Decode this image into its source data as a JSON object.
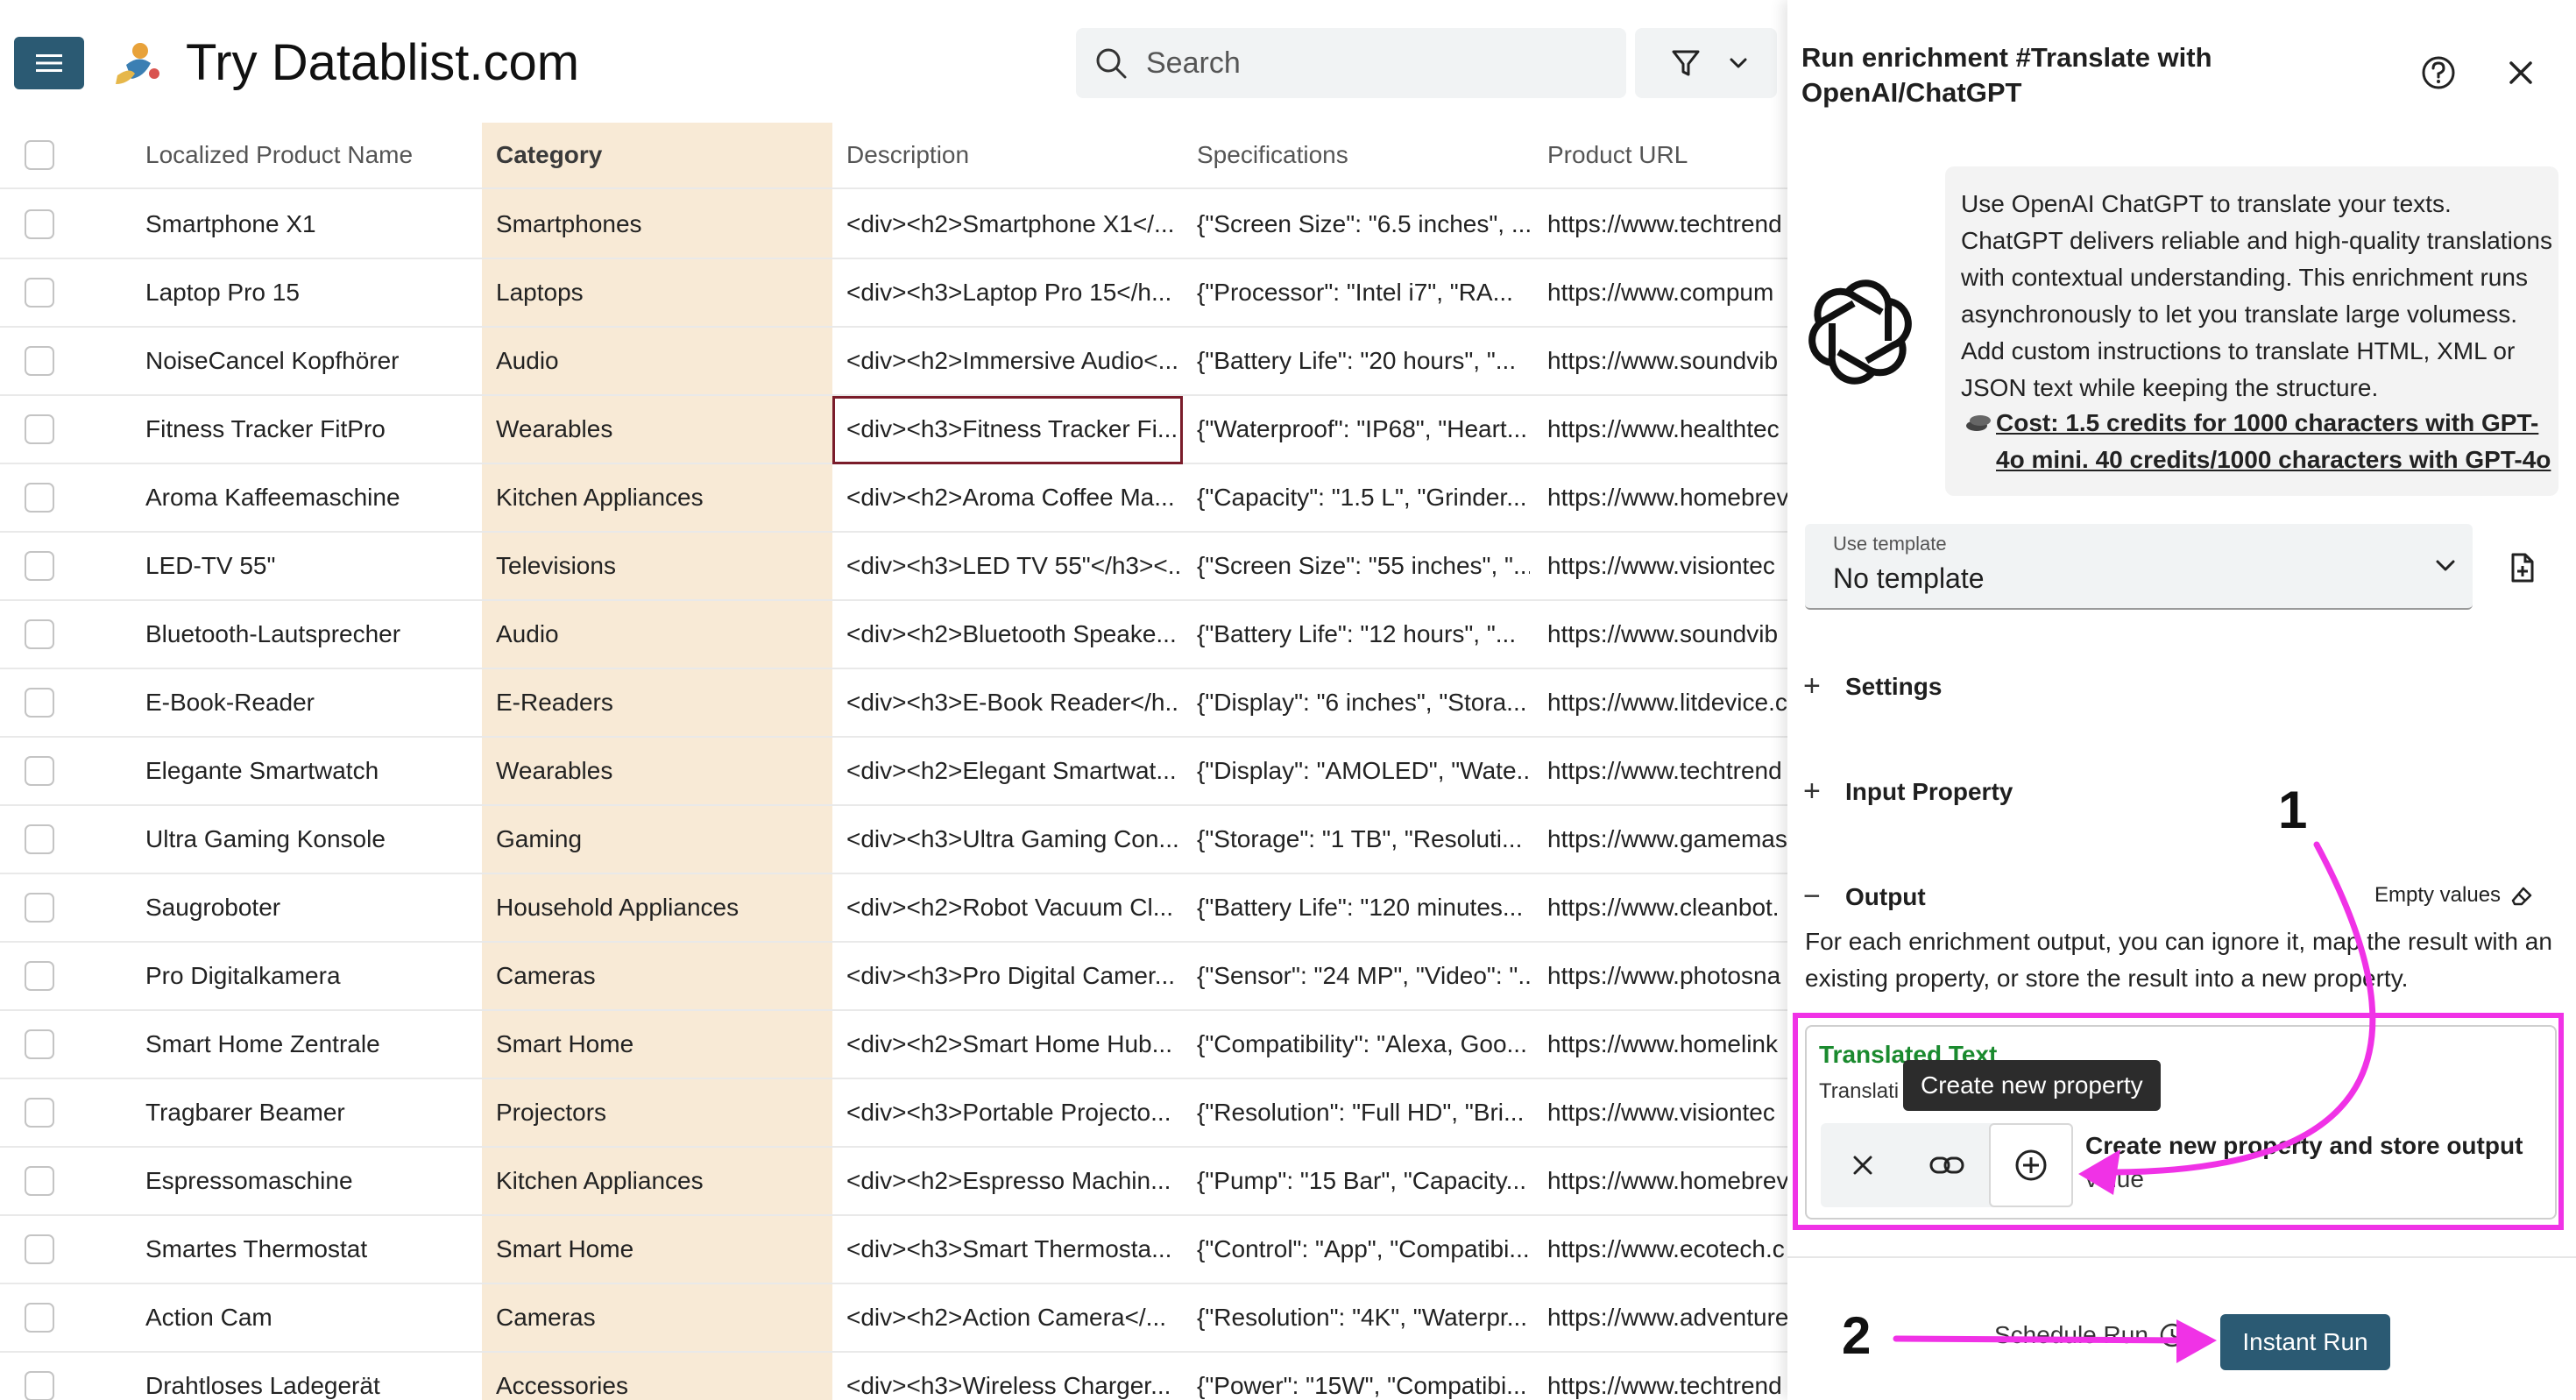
{
  "app": {
    "brand": "Try Datablist.com",
    "search_placeholder": "Search"
  },
  "table": {
    "headers": [
      "Localized Product Name",
      "Category",
      "Description",
      "Specifications",
      "Product URL"
    ],
    "rows": [
      {
        "name": "Smartphone X1",
        "category": "Smartphones",
        "description": "<div><h2>Smartphone X1</...",
        "specs": "{\"Screen Size\": \"6.5 inches\", ...",
        "url": "https://www.techtrend"
      },
      {
        "name": "Laptop Pro 15",
        "category": "Laptops",
        "description": "<div><h3>Laptop Pro 15</h...",
        "specs": "{\"Processor\": \"Intel i7\", \"RA...",
        "url": "https://www.compum"
      },
      {
        "name": "NoiseCancel Kopfhörer",
        "category": "Audio",
        "description": "<div><h2>Immersive Audio<...",
        "specs": "{\"Battery Life\": \"20 hours\", \"...",
        "url": "https://www.soundvib"
      },
      {
        "name": "Fitness Tracker FitPro",
        "category": "Wearables",
        "description": "<div><h3>Fitness Tracker Fi...",
        "specs": "{\"Waterproof\": \"IP68\", \"Heart...",
        "url": "https://www.healthtec"
      },
      {
        "name": "Aroma Kaffeemaschine",
        "category": "Kitchen Appliances",
        "description": "<div><h2>Aroma Coffee Ma...",
        "specs": "{\"Capacity\": \"1.5 L\", \"Grinder...",
        "url": "https://www.homebrev"
      },
      {
        "name": "LED-TV 55\"",
        "category": "Televisions",
        "description": "<div><h3>LED TV 55\"</h3><...",
        "specs": "{\"Screen Size\": \"55 inches\", \"...",
        "url": "https://www.visiontec"
      },
      {
        "name": "Bluetooth-Lautsprecher",
        "category": "Audio",
        "description": "<div><h2>Bluetooth Speake...",
        "specs": "{\"Battery Life\": \"12 hours\", \"...",
        "url": "https://www.soundvib"
      },
      {
        "name": "E-Book-Reader",
        "category": "E-Readers",
        "description": "<div><h3>E-Book Reader</h...",
        "specs": "{\"Display\": \"6 inches\", \"Stora...",
        "url": "https://www.litdevice.c"
      },
      {
        "name": "Elegante Smartwatch",
        "category": "Wearables",
        "description": "<div><h2>Elegant Smartwat...",
        "specs": "{\"Display\": \"AMOLED\", \"Wate...",
        "url": "https://www.techtrend"
      },
      {
        "name": "Ultra Gaming Konsole",
        "category": "Gaming",
        "description": "<div><h3>Ultra Gaming Con...",
        "specs": "{\"Storage\": \"1 TB\", \"Resoluti...",
        "url": "https://www.gamemas"
      },
      {
        "name": "Saugroboter",
        "category": "Household Appliances",
        "description": "<div><h2>Robot Vacuum Cl...",
        "specs": "{\"Battery Life\": \"120 minutes...",
        "url": "https://www.cleanbot."
      },
      {
        "name": "Pro Digitalkamera",
        "category": "Cameras",
        "description": "<div><h3>Pro Digital Camer...",
        "specs": "{\"Sensor\": \"24 MP\", \"Video\": \"...",
        "url": "https://www.photosna"
      },
      {
        "name": "Smart Home Zentrale",
        "category": "Smart Home",
        "description": "<div><h2>Smart Home Hub...",
        "specs": "{\"Compatibility\": \"Alexa, Goo...",
        "url": "https://www.homelink"
      },
      {
        "name": "Tragbarer Beamer",
        "category": "Projectors",
        "description": "<div><h3>Portable Projecto...",
        "specs": "{\"Resolution\": \"Full HD\", \"Bri...",
        "url": "https://www.visiontec"
      },
      {
        "name": "Espressomaschine",
        "category": "Kitchen Appliances",
        "description": "<div><h2>Espresso Machin...",
        "specs": "{\"Pump\": \"15 Bar\", \"Capacity...",
        "url": "https://www.homebrev"
      },
      {
        "name": "Smartes Thermostat",
        "category": "Smart Home",
        "description": "<div><h3>Smart Thermosta...",
        "specs": "{\"Control\": \"App\", \"Compatibi...",
        "url": "https://www.ecotech.c"
      },
      {
        "name": "Action Cam",
        "category": "Cameras",
        "description": "<div><h2>Action Camera</...",
        "specs": "{\"Resolution\": \"4K\", \"Waterpr...",
        "url": "https://www.adventure"
      },
      {
        "name": "Drahtloses Ladegerät",
        "category": "Accessories",
        "description": "<div><h3>Wireless Charger...",
        "specs": "{\"Power\": \"15W\", \"Compatibi...",
        "url": "https://www.techtrend"
      }
    ]
  },
  "panel": {
    "title": "Run enrichment #Translate with OpenAI/ChatGPT",
    "info_text": "Use OpenAI ChatGPT to translate your texts. ChatGPT delivers reliable and high-quality translations with contextual understanding. This enrichment runs asynchronously to let you translate large volumess. Add custom instructions to translate HTML, XML or JSON text while keeping the structure.",
    "cost_text": "Cost: 1.5 credits for 1000 characters with GPT-4o mini. 40 credits/1000 characters with GPT-4o",
    "template_label": "Use template",
    "template_value": "No template",
    "settings_label": "Settings",
    "input_property_label": "Input Property",
    "output_label": "Output",
    "empty_values_label": "Empty values",
    "output_desc": "For each enrichment output, you can ignore it, map the result with an existing property, or store the result into a new property.",
    "output_field_name": "Translated Text",
    "output_field_sub": "Translati",
    "tooltip": "Create new property",
    "action_label": "Create new property and store output",
    "action_label2": "value",
    "schedule_label": "Schedule Run",
    "instant_label": "Instant Run"
  },
  "annotations": {
    "step1": "1",
    "step2": "2",
    "highlight_color": "#f032e6"
  },
  "colors": {
    "primary": "#2b5a73",
    "category_col": "#f8ead6",
    "output_name": "#1a8a2e"
  }
}
